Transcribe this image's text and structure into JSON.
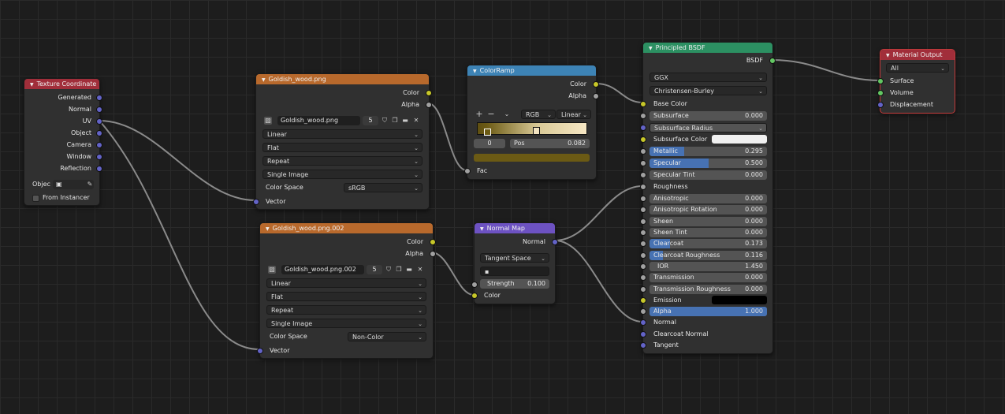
{
  "colors": {
    "texcoord_header": "#a12e3a",
    "image_header": "#b8692c",
    "colorramp_header": "#3d83b5",
    "normalmap_header": "#6d52c2",
    "bsdf_header": "#2c9062",
    "output_header": "#a12e3a",
    "socket_color": "#c7c729",
    "socket_float": "#a1a1a1",
    "socket_vector": "#6363c7",
    "socket_shader": "#63c763",
    "field_fill": "#4772b3"
  },
  "texcoord": {
    "title": "Texture Coordinate",
    "outputs": [
      "Generated",
      "Normal",
      "UV",
      "Object",
      "Camera",
      "Window",
      "Reflection"
    ],
    "object_label": "Objec",
    "from_instancer": "From Instancer"
  },
  "image1": {
    "title": "Goldish_wood.png",
    "out_color": "Color",
    "out_alpha": "Alpha",
    "image_name": "Goldish_wood.png",
    "users": "5",
    "interpolation": "Linear",
    "projection": "Flat",
    "extension": "Repeat",
    "source": "Single Image",
    "color_space_label": "Color Space",
    "color_space": "sRGB",
    "in_vector": "Vector"
  },
  "image2": {
    "title": "Goldish_wood.png.002",
    "out_color": "Color",
    "out_alpha": "Alpha",
    "image_name": "Goldish_wood.png.002",
    "users": "5",
    "interpolation": "Linear",
    "projection": "Flat",
    "extension": "Repeat",
    "source": "Single Image",
    "color_space_label": "Color Space",
    "color_space": "Non-Color",
    "in_vector": "Vector"
  },
  "colorramp": {
    "title": "ColorRamp",
    "out_color": "Color",
    "out_alpha": "Alpha",
    "add": "+",
    "remove": "−",
    "mode": "RGB",
    "interpolation": "Linear",
    "stop_index": "0",
    "pos_label": "Pos",
    "pos_value": "0.082",
    "in_fac": "Fac",
    "stop_color": "#6b5a14"
  },
  "normalmap": {
    "title": "Normal Map",
    "out_normal": "Normal",
    "space": "Tangent Space",
    "strength_label": "Strength",
    "strength_value": "0.100",
    "in_color": "Color"
  },
  "bsdf": {
    "title": "Principled BSDF",
    "out_bsdf": "BSDF",
    "distribution": "GGX",
    "subsurface_method": "Christensen-Burley",
    "base_color": "Base Color",
    "subsurface": {
      "label": "Subsurface",
      "value": "0.000",
      "fill": 0
    },
    "subsurface_radius": "Subsurface Radius",
    "subsurface_color": "Subsurface Color",
    "metallic": {
      "label": "Metallic",
      "value": "0.295",
      "fill": 0.295
    },
    "specular": {
      "label": "Specular",
      "value": "0.500",
      "fill": 0.5
    },
    "specular_tint": {
      "label": "Specular Tint",
      "value": "0.000",
      "fill": 0
    },
    "roughness": "Roughness",
    "anisotropic": {
      "label": "Anisotropic",
      "value": "0.000",
      "fill": 0
    },
    "anisotropic_rotation": {
      "label": "Anisotropic Rotation",
      "value": "0.000",
      "fill": 0
    },
    "sheen": {
      "label": "Sheen",
      "value": "0.000",
      "fill": 0
    },
    "sheen_tint": {
      "label": "Sheen Tint",
      "value": "0.000",
      "fill": 0
    },
    "clearcoat": {
      "label": "Clearcoat",
      "value": "0.173",
      "fill": 0.173
    },
    "clearcoat_roughness": {
      "label": "Clearcoat Roughness",
      "value": "0.116",
      "fill": 0.116
    },
    "ior": {
      "label": "IOR",
      "value": "1.450"
    },
    "transmission": {
      "label": "Transmission",
      "value": "0.000",
      "fill": 0
    },
    "transmission_roughness": {
      "label": "Transmission Roughness",
      "value": "0.000",
      "fill": 0
    },
    "emission": "Emission",
    "alpha": {
      "label": "Alpha",
      "value": "1.000",
      "fill": 1
    },
    "normal": "Normal",
    "clearcoat_normal": "Clearcoat Normal",
    "tangent": "Tangent"
  },
  "output": {
    "title": "Material Output",
    "target": "All",
    "surface": "Surface",
    "volume": "Volume",
    "displacement": "Displacement"
  }
}
